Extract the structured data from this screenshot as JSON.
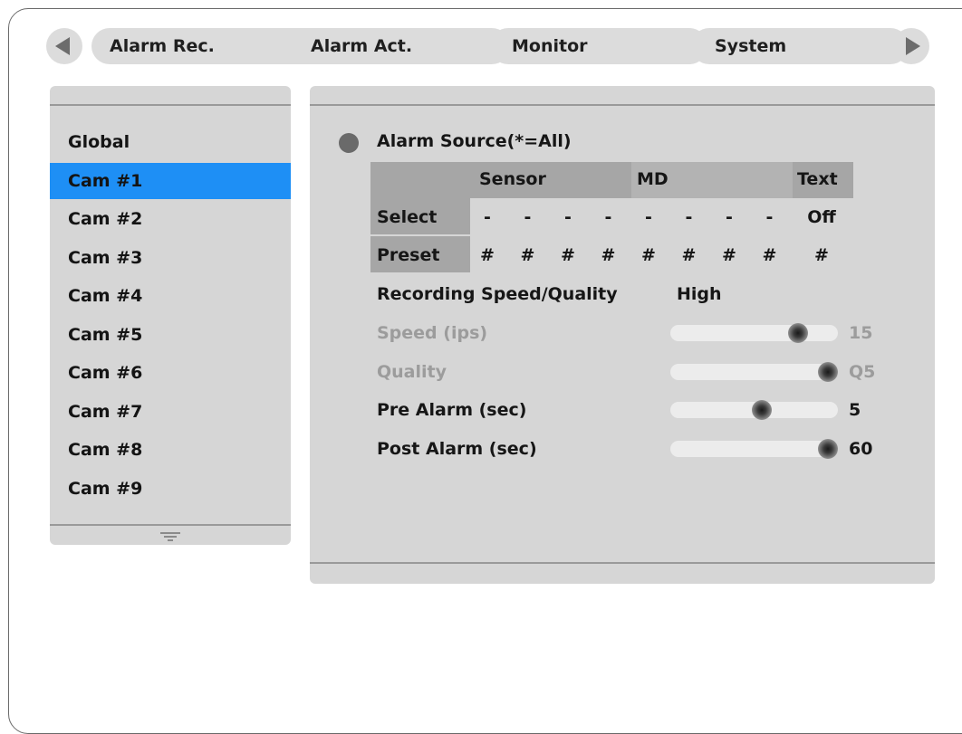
{
  "tabs": {
    "items": [
      {
        "label": "Alarm Rec.",
        "active": true
      },
      {
        "label": "Alarm Act.",
        "active": false
      },
      {
        "label": "Monitor",
        "active": false
      },
      {
        "label": "System",
        "active": false
      }
    ],
    "prev_icon": "triangle-left-icon",
    "next_icon": "triangle-right-icon"
  },
  "sidebar": {
    "items": [
      {
        "label": "Global",
        "selected": false
      },
      {
        "label": "Cam #1",
        "selected": true
      },
      {
        "label": "Cam #2",
        "selected": false
      },
      {
        "label": "Cam #3",
        "selected": false
      },
      {
        "label": "Cam #4",
        "selected": false
      },
      {
        "label": "Cam #5",
        "selected": false
      },
      {
        "label": "Cam #6",
        "selected": false
      },
      {
        "label": "Cam #7",
        "selected": false
      },
      {
        "label": "Cam #8",
        "selected": false
      },
      {
        "label": "Cam #9",
        "selected": false
      }
    ],
    "scroll_icon": "scroll-down-icon"
  },
  "alarm_source": {
    "title": "Alarm Source(*=All)",
    "headers": {
      "sensor": "Sensor",
      "md": "MD",
      "text": "Text"
    },
    "select": {
      "label": "Select",
      "values": [
        "-",
        "-",
        "-",
        "-",
        "-",
        "-",
        "-",
        "-"
      ],
      "text": "Off"
    },
    "preset": {
      "label": "Preset",
      "values": [
        "#",
        "#",
        "#",
        "#",
        "#",
        "#",
        "#",
        "#"
      ],
      "text": "#"
    }
  },
  "recording": {
    "label": "Recording Speed/Quality",
    "value": "High"
  },
  "sliders": [
    {
      "label": "Speed (ips)",
      "value": "15",
      "level": 0.8,
      "enabled": false
    },
    {
      "label": "Quality",
      "value": "Q5",
      "level": 1.0,
      "enabled": false
    },
    {
      "label": "Pre Alarm (sec)",
      "value": "5",
      "level": 0.55,
      "enabled": true
    },
    {
      "label": "Post Alarm (sec)",
      "value": "60",
      "level": 1.0,
      "enabled": true
    }
  ],
  "colors": {
    "accent": "#1e8ff5",
    "panel": "#d6d6d6",
    "table_header": "#a6a6a6",
    "dim_text": "#9c9c9c"
  }
}
